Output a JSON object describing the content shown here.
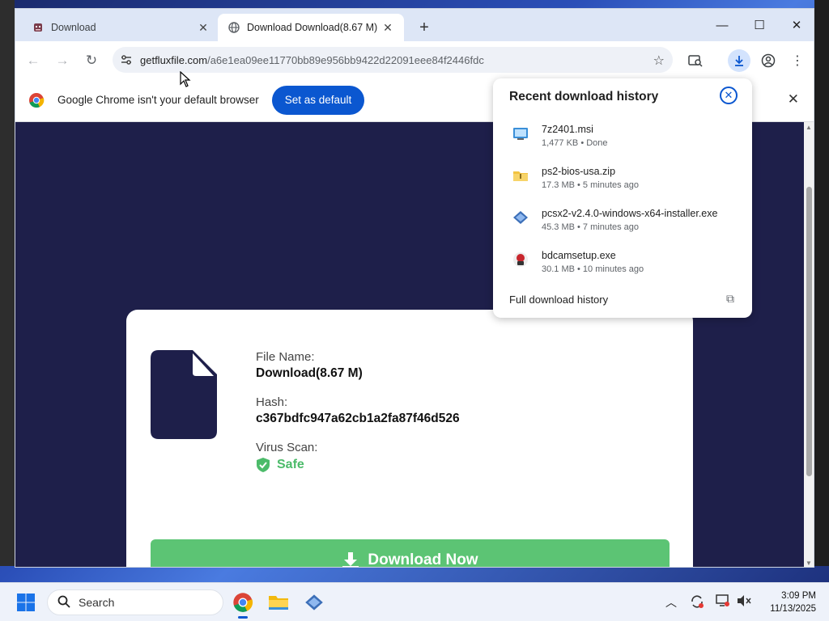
{
  "tabs": [
    {
      "label": "Download",
      "active": false
    },
    {
      "label": "Download Download(8.67 M)",
      "active": true
    }
  ],
  "window_controls": {
    "minimize": "—",
    "maximize": "☐",
    "close": "✕"
  },
  "address_bar": {
    "domain": "getfluxfile.com",
    "path": "/a6e1ea09ee11770bb89e956bb9422d22091eee84f2446fdc"
  },
  "infobar": {
    "message": "Google Chrome isn't your default browser",
    "button": "Set as default"
  },
  "download_popup": {
    "title": "Recent download history",
    "items": [
      {
        "name": "7z2401.msi",
        "meta": "1,477 KB • Done",
        "icon": "msi-installer-icon"
      },
      {
        "name": "ps2-bios-usa.zip",
        "meta": "17.3 MB • 5 minutes ago",
        "icon": "zip-folder-icon"
      },
      {
        "name": "pcsx2-v2.4.0-windows-x64-installer.exe",
        "meta": "45.3 MB • 7 minutes ago",
        "icon": "pcsx2-icon"
      },
      {
        "name": "bdcamsetup.exe",
        "meta": "30.1 MB • 10 minutes ago",
        "icon": "bandicam-icon"
      }
    ],
    "full_history": "Full download history"
  },
  "file_card": {
    "file_name_label": "File Name:",
    "file_name": "Download(8.67 M)",
    "hash_label": "Hash:",
    "hash": "c367bdfc947a62cb1a2fa87f46d526",
    "scan_label": "Virus Scan:",
    "scan_result": "Safe",
    "download_button": "Download Now"
  },
  "taskbar": {
    "search_placeholder": "Search",
    "time": "3:09 PM",
    "date": "11/13/2025"
  },
  "colors": {
    "page_bg": "#1e1f4a",
    "accent_blue": "#0b57d0",
    "safe_green": "#4cbb6a",
    "download_green": "#5cc474"
  }
}
